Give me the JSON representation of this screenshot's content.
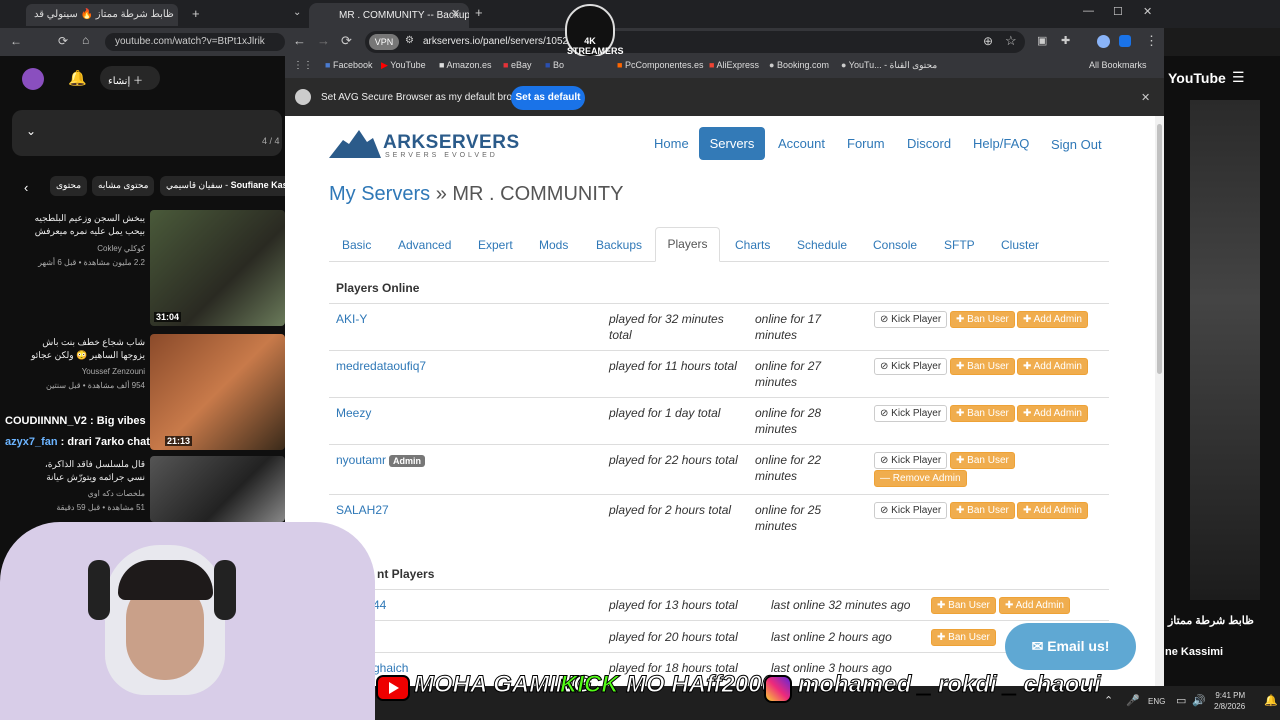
{
  "background_browser": {
    "tab_title": "ظابط شرطة ممتاز 🔥 سينولي قد",
    "url": "youtube.com/watch?v=BtPt1xJlrik",
    "create_label": "إنشاء",
    "counter": "4 / 4",
    "chips": [
      "محتوى",
      "محتوى مشابه",
      "سفيان قاسيمي",
      "Soufiane Kass"
    ],
    "videos": [
      {
        "title": "يبخش السجن وزعيم البلطجيه بيحب يمل عليه نمره ميعرفش انه وحـ...",
        "channel": "كوكلي Cokley",
        "meta": "2.2 مليون مشاهدة • قبل 6 أشهر",
        "duration": "31:04"
      },
      {
        "title": "شاب شجاع خطف بنت باش يزوجها الساهير 😳 ولكن عجائو ولا ...",
        "channel": "Youssef Zenzouni",
        "meta": "954 ألف مشاهدة • قبل سنتين",
        "duration": "21:13"
      },
      {
        "title": "قال ملسلسل فاقد الذاكرة، نسي جرائمه ويتورّش عيانة الخطر و...",
        "channel": "ملخصات دكه اوي",
        "meta": "51 مشاهدة • قبل 59 دقيقة",
        "duration": ""
      }
    ],
    "chat": [
      {
        "user": "COUDIINNN_V2",
        "msg": ": Big vibes"
      },
      {
        "user": "azyx7_fan",
        "msg": ": drari 7arko chat"
      }
    ],
    "right_logo": "YouTube",
    "right_caption": "ظابط شرطة ممتاز",
    "right_channel": "ne Kassimi"
  },
  "browser": {
    "tab_title": "MR . COMMUNITY -- Backups |",
    "vpn_label": "VPN",
    "url": "arkservers.io/panel/servers/10527",
    "bookmarks": [
      "Facebook",
      "YouTube",
      "Amazon.es",
      "eBay",
      "Bo",
      "PcComponentes.es",
      "AliExpress",
      "Booking.com",
      "YouTu... - محتوى القناة",
      "All Bookmarks"
    ],
    "notice_text": "Set AVG Secure Browser as my default browser",
    "notice_button": "Set as default",
    "overlay_logo": "4K STREAMERS"
  },
  "site": {
    "logo_main": "ARKSERVERS",
    "logo_sub": "SERVERS EVOLVED",
    "nav": [
      "Home",
      "Servers",
      "Account",
      "Forum",
      "Discord",
      "Help/FAQ",
      "Sign Out"
    ],
    "crumb_link": "My Servers",
    "crumb_sep": "»",
    "crumb_current": "MR . COMMUNITY",
    "tabs": [
      "Basic",
      "Advanced",
      "Expert",
      "Mods",
      "Backups",
      "Players",
      "Charts",
      "Schedule",
      "Console",
      "SFTP",
      "Cluster"
    ],
    "players_online_title": "Players Online",
    "kick_label": "Kick Player",
    "ban_label": "Ban User",
    "add_admin_label": "Add Admin",
    "remove_admin_label": "Remove Admin",
    "players_online": [
      {
        "name": "AKI-Y",
        "played": "played for 32 minutes total",
        "online": "online for 17 minutes",
        "admin": false
      },
      {
        "name": "medredataoufiq7",
        "played": "played for 11 hours total",
        "online": "online for 27 minutes",
        "admin": false
      },
      {
        "name": "Meezy",
        "played": "played for 1 day total",
        "online": "online for 28 minutes",
        "admin": false
      },
      {
        "name": "nyoutamr",
        "badge": "Admin",
        "played": "played for 22 hours total",
        "online": "online for 22 minutes",
        "admin": true
      },
      {
        "name": "SALAH27",
        "played": "played for 2 hours total",
        "online": "online for 25 minutes",
        "admin": false
      }
    ],
    "recent_title": "nt Players",
    "recent_players": [
      {
        "name": "44",
        "played": "played for 13 hours total",
        "last": "last online 32 minutes ago"
      },
      {
        "name": "",
        "played": "played for 20 hours total",
        "last": "last online 2 hours ago"
      },
      {
        "name": "ghaich",
        "played": "played for 18 hours total",
        "last": "last online 3 hours ago"
      }
    ],
    "email_button": "Email us!"
  },
  "overlay": {
    "brand1": "MOHA GAMING",
    "brand2_prefix": "KICK",
    "brand2": "MO HAff2000",
    "brand3": "mohamed _ rokdi _ chaoui"
  },
  "taskbar": {
    "lang": "ENG",
    "time": "9:41 PM",
    "date": "2/8/2026"
  }
}
